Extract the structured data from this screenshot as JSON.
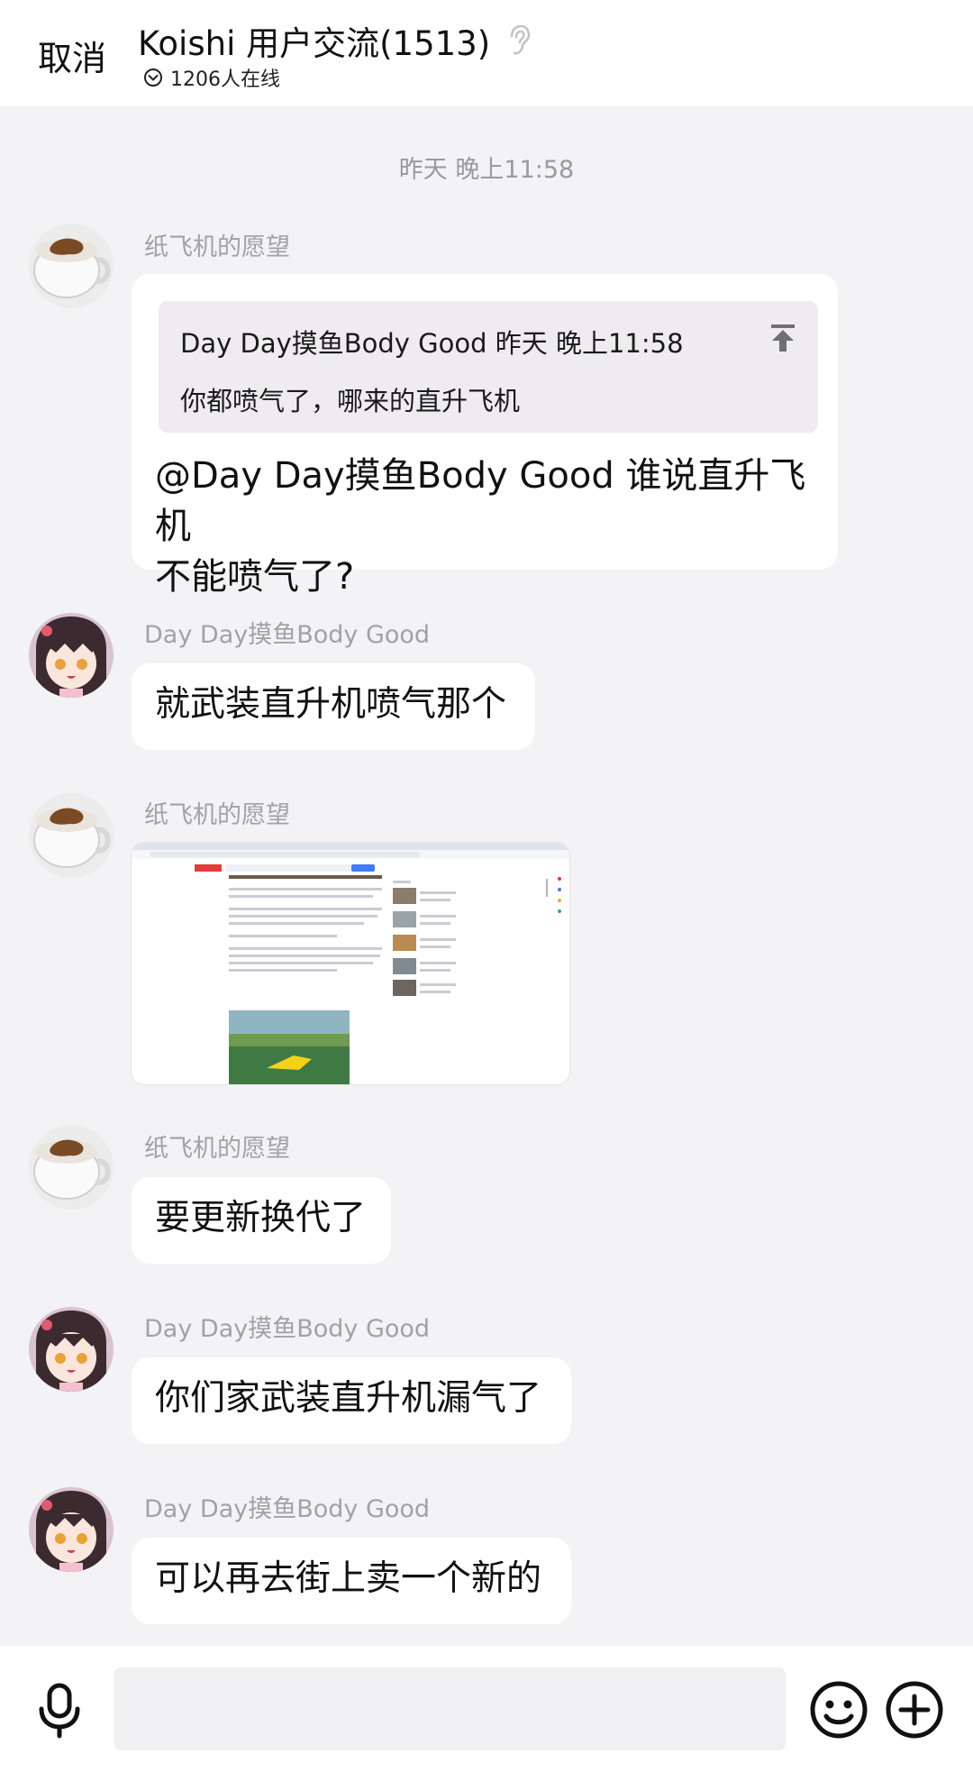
{
  "header": {
    "cancel_label": "取消",
    "group_name": "Koishi 用户交流(1513)",
    "online_status": "1206人在线"
  },
  "chat": {
    "timestamp": "昨天 晚上11:58",
    "messages": [
      {
        "sender": "纸飞机的愿望",
        "avatar": "coffee-cup-avatar",
        "quote": {
          "header": "Day Day摸鱼Body Good 昨天 晚上11:58",
          "text": "你都喷气了，哪来的直升飞机"
        },
        "text_line1": "@Day Day摸鱼Body Good 谁说直升飞机",
        "text_line2": "不能喷气了?"
      },
      {
        "sender": "Day Day摸鱼Body Good",
        "avatar": "anime-girl-avatar",
        "text": "就武装直升机喷气那个"
      },
      {
        "sender": "纸飞机的愿望",
        "avatar": "coffee-cup-avatar",
        "type": "image",
        "image_desc": "browser-screenshot"
      },
      {
        "sender": "纸飞机的愿望",
        "avatar": "coffee-cup-avatar",
        "text": "要更新换代了"
      },
      {
        "sender": "Day Day摸鱼Body Good",
        "avatar": "anime-girl-avatar",
        "text": "你们家武装直升机漏气了"
      },
      {
        "sender": "Day Day摸鱼Body Good",
        "avatar": "anime-girl-avatar",
        "text": "可以再去街上卖一个新的"
      }
    ]
  },
  "input_bar": {
    "placeholder": "",
    "icons": [
      "microphone-icon",
      "emoji-icon",
      "plus-icon"
    ]
  },
  "colors": {
    "background": "#f3f2f5",
    "bubble": "#ffffff",
    "sender_name": "#a2a2a6",
    "quote_bg": "#eeecef"
  }
}
